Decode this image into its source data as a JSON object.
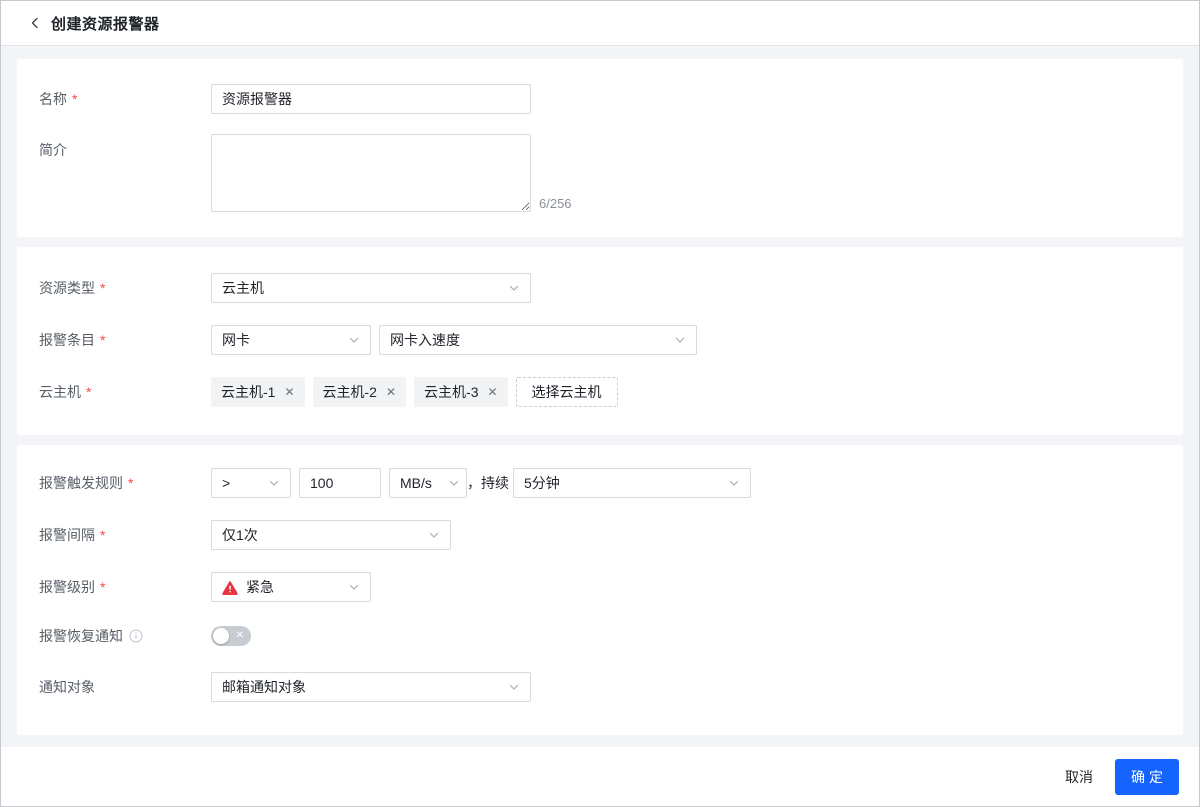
{
  "header": {
    "title": "创建资源报警器"
  },
  "colors": {
    "primary": "#1664FF",
    "danger": "#E5353E",
    "tag_background": "#F2F3F5",
    "page_background": "#F3F5F9"
  },
  "form": {
    "required_mark": "*",
    "basic": {
      "name": {
        "label": "名称",
        "value": "资源报警器"
      },
      "intro": {
        "label": "简介",
        "value": "",
        "counter": "6/256"
      }
    },
    "resource": {
      "type": {
        "label": "资源类型",
        "value": "云主机"
      },
      "entry": {
        "label": "报警条目",
        "category": "网卡",
        "metric": "网卡入速度"
      },
      "hosts": {
        "label": "云主机",
        "tags": [
          "云主机-1",
          "云主机-2",
          "云主机-3"
        ],
        "remove_icon": "✕",
        "select_button": "选择云主机"
      }
    },
    "rule": {
      "trigger": {
        "label": "报警触发规则",
        "operator": ">",
        "threshold": "100",
        "unit": "MB/s",
        "duration_prefix": "，持续",
        "duration": "5分钟"
      },
      "interval": {
        "label": "报警间隔",
        "value": "仅1次"
      },
      "level": {
        "label": "报警级别",
        "value": "紧急"
      },
      "recovery": {
        "label": "报警恢复通知",
        "state": "off",
        "off_icon": "✕"
      },
      "notify": {
        "label": "通知对象",
        "value": "邮箱通知对象"
      }
    }
  },
  "footer": {
    "cancel_label": "取消",
    "confirm_label": "确定"
  }
}
